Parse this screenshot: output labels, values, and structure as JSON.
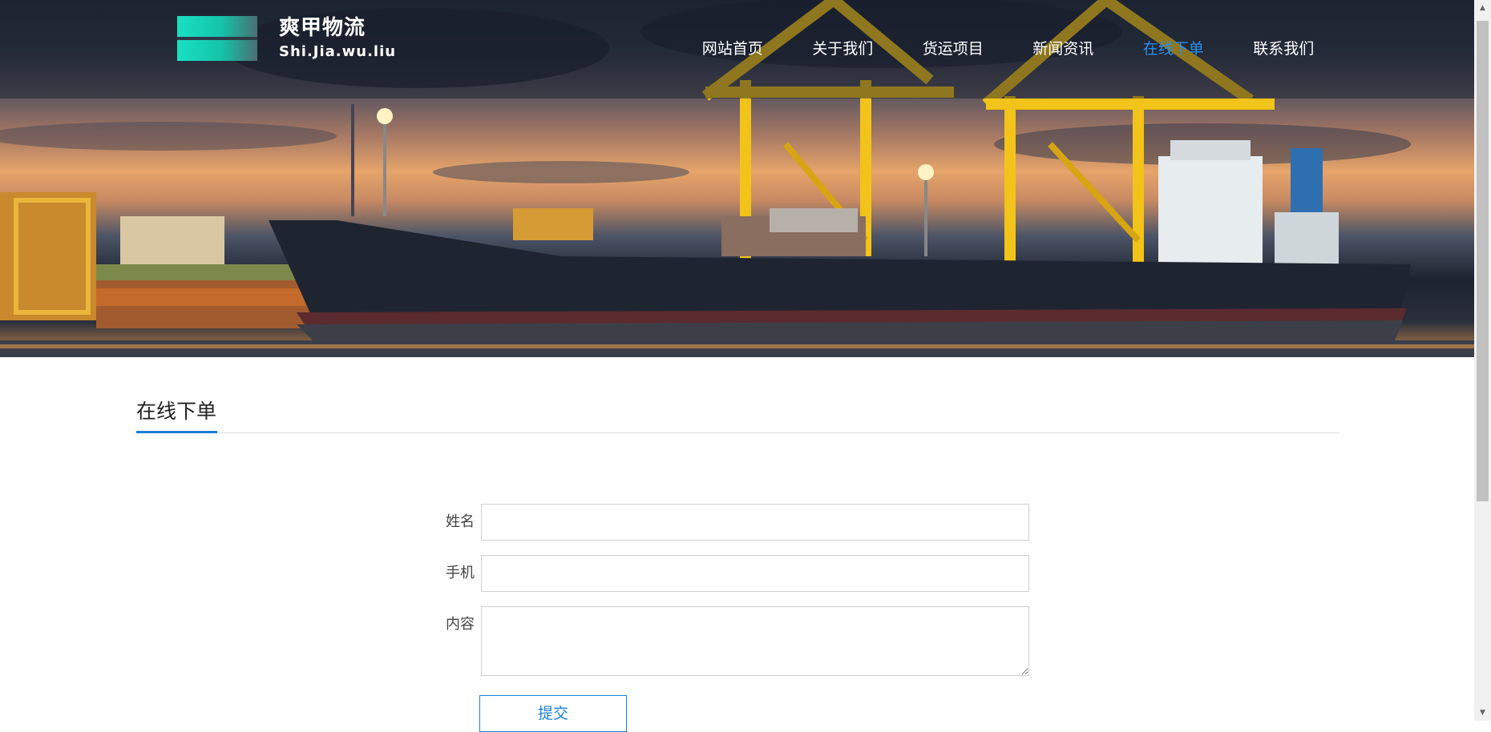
{
  "brand": {
    "name_cn": "爽甲物流",
    "name_en": "Shi.Jia.wu.liu",
    "logo_colors": [
      "#19e0c3",
      "#4a6f73"
    ]
  },
  "nav": {
    "items": [
      {
        "label": "网站首页",
        "active": false
      },
      {
        "label": "关于我们",
        "active": false
      },
      {
        "label": "货运项目",
        "active": false
      },
      {
        "label": "新闻资讯",
        "active": false
      },
      {
        "label": "在线下单",
        "active": true
      },
      {
        "label": "联系我们",
        "active": false
      }
    ],
    "active_color": "#2a8fe8"
  },
  "hero": {
    "image_description_icon": "cargo-ship-port-banner"
  },
  "section": {
    "title": "在线下单",
    "accent_color": "#1a7fd6"
  },
  "form": {
    "name_label": "姓名",
    "name_value": "",
    "phone_label": "手机",
    "phone_value": "",
    "content_label": "内容",
    "content_value": "",
    "submit_label": "提交"
  },
  "scrollbar": {
    "up_icon": "scroll-up-arrow",
    "down_icon": "scroll-down-arrow"
  }
}
